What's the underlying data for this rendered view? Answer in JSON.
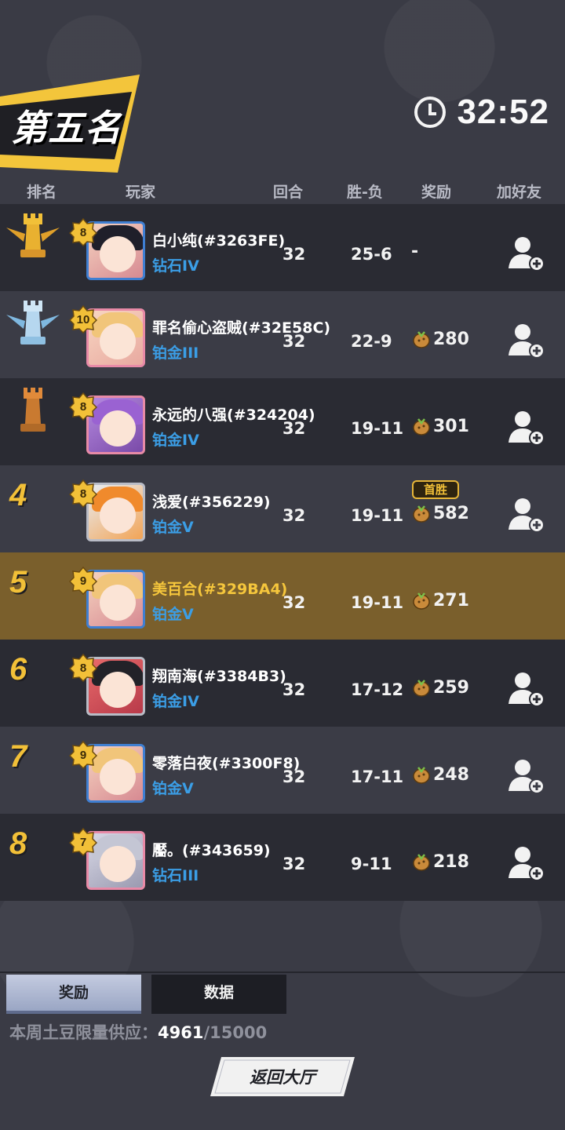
{
  "header": {
    "placement": "第五名",
    "timer": "32:52"
  },
  "columns": {
    "rank": "排名",
    "player": "玩家",
    "rounds": "回合",
    "win_loss": "胜-负",
    "reward": "奖励",
    "add_friend": "加好友"
  },
  "players": [
    {
      "rank_display": "",
      "rank_icon": "gold-rook-icon",
      "level": "8",
      "name": "白小纯(#3263FE)",
      "tier": "钻石IV",
      "rounds": "32",
      "win_loss": "25-6",
      "reward": "-",
      "badge": ""
    },
    {
      "rank_display": "",
      "rank_icon": "silver-rook-icon",
      "level": "10",
      "name": "罪名偷心盗贼(#32E58C)",
      "tier": "铂金III",
      "rounds": "32",
      "win_loss": "22-9",
      "reward": "280",
      "badge": ""
    },
    {
      "rank_display": "",
      "rank_icon": "bronze-rook-icon",
      "level": "8",
      "name": "永远的八强(#324204)",
      "tier": "铂金IV",
      "rounds": "32",
      "win_loss": "19-11",
      "reward": "301",
      "badge": ""
    },
    {
      "rank_display": "4",
      "level": "8",
      "name": "浅爱(#356229)",
      "tier": "铂金V",
      "rounds": "32",
      "win_loss": "19-11",
      "reward": "582",
      "badge": "首胜"
    },
    {
      "rank_display": "5",
      "level": "9",
      "name": "美百合(#329BA4)",
      "tier": "铂金V",
      "rounds": "32",
      "win_loss": "19-11",
      "reward": "271",
      "badge": ""
    },
    {
      "rank_display": "6",
      "level": "8",
      "name": "翔南海(#3384B3)",
      "tier": "铂金IV",
      "rounds": "32",
      "win_loss": "17-12",
      "reward": "259",
      "badge": ""
    },
    {
      "rank_display": "7",
      "level": "9",
      "name": "零落白夜(#3300F8)",
      "tier": "铂金V",
      "rounds": "32",
      "win_loss": "17-11",
      "reward": "248",
      "badge": ""
    },
    {
      "rank_display": "8",
      "level": "7",
      "name": "靨。(#343659)",
      "tier": "钻石III",
      "rounds": "32",
      "win_loss": "9-11",
      "reward": "218",
      "badge": ""
    }
  ],
  "tabs": {
    "reward": "奖励",
    "data": "数据"
  },
  "supply": {
    "label": "本周土豆限量供应：",
    "current": "4961",
    "total": "/15000"
  },
  "return_button": "返回大厅",
  "colors": {
    "gold": "#f2c038",
    "tier_blue": "#3b9ee6",
    "self_row": "#7a5f2c"
  }
}
